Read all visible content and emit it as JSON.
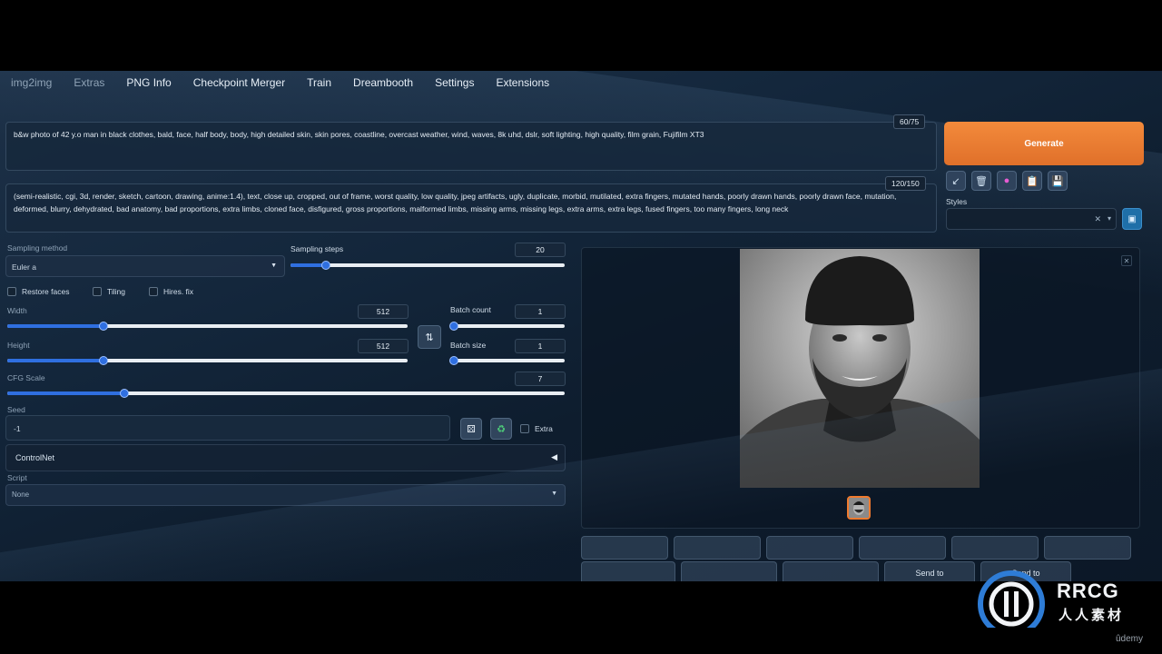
{
  "tabs": [
    "img2img",
    "Extras",
    "PNG Info",
    "Checkpoint Merger",
    "Train",
    "Dreambooth",
    "Settings",
    "Extensions"
  ],
  "prompt": {
    "positive": "b&w photo of 42 y.o man in black clothes, bald, face, half body, body, high detailed skin, skin pores, coastline, overcast weather, wind, waves, 8k uhd, dslr, soft lighting, high quality, film grain, Fujifilm XT3",
    "positive_tokens": "60/75",
    "negative": "(semi-realistic, cgi, 3d, render, sketch, cartoon, drawing, anime:1.4), text, close up, cropped, out of frame, worst quality, low quality, jpeg artifacts, ugly, duplicate, morbid, mutilated, extra fingers, mutated hands, poorly drawn hands, poorly drawn face, mutation, deformed, blurry, dehydrated, bad anatomy, bad proportions, extra limbs, cloned face, disfigured, gross proportions, malformed limbs, missing arms, missing legs, extra arms, extra legs, fused fingers, too many fingers, long neck",
    "negative_tokens": "120/150"
  },
  "generate_label": "Generate",
  "tools": [
    "arrow-icon",
    "trash-icon",
    "extra-networks-icon",
    "paste-icon",
    "save-style-icon"
  ],
  "styles": {
    "label": "Styles",
    "value": ""
  },
  "sampling": {
    "method_label": "Sampling method",
    "method_value": "Euler a",
    "steps_label": "Sampling steps",
    "steps_value": "20",
    "steps_fraction": 0.13
  },
  "checks": {
    "restore_faces": "Restore faces",
    "tiling": "Tiling",
    "hires": "Hires. fix"
  },
  "width": {
    "label": "Width",
    "value": "512",
    "fraction": 0.24
  },
  "height": {
    "label": "Height",
    "value": "512",
    "fraction": 0.24
  },
  "batch_count": {
    "label": "Batch count",
    "value": "1",
    "fraction": 0.0
  },
  "batch_size": {
    "label": "Batch size",
    "value": "1",
    "fraction": 0.0
  },
  "cfg": {
    "label": "CFG Scale",
    "value": "7",
    "fraction": 0.21
  },
  "seed": {
    "label": "Seed",
    "value": "-1",
    "extra_label": "Extra"
  },
  "controlnet_label": "ControlNet",
  "script": {
    "label": "Script",
    "value": "None"
  },
  "send_to": [
    "Send to",
    "Send to"
  ],
  "watermark": {
    "brand": "RRCG",
    "sub": "人人素材",
    "site": "ûdemy"
  },
  "colors": {
    "accent": "#e0702a",
    "slider": "#2f6fe0",
    "background": "#13263b"
  }
}
